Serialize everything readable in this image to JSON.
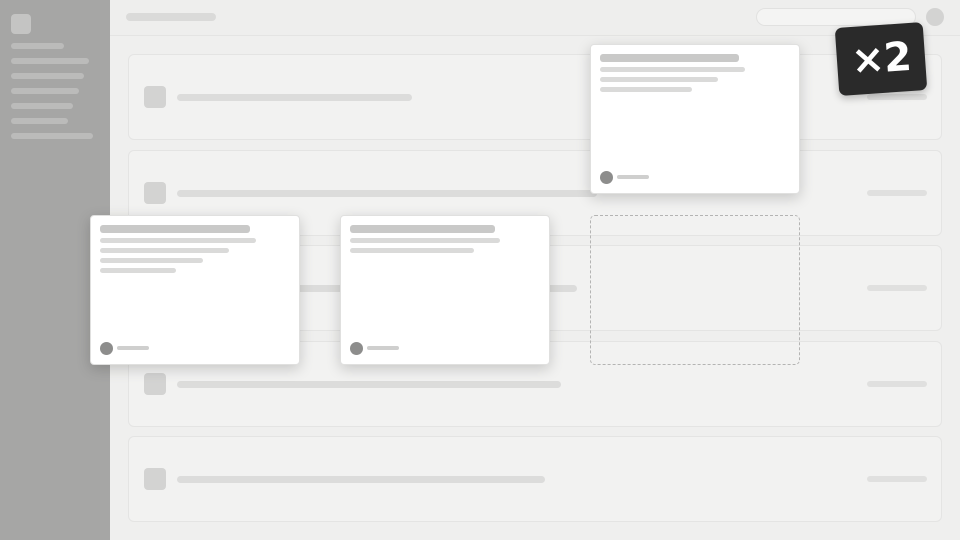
{
  "badge": {
    "multiplier": "×2"
  },
  "sidebar": {
    "item_count": 7
  },
  "rows": {
    "count": 5
  },
  "cards": {
    "count": 3
  },
  "colors": {
    "sidebar": "#a6a6a5",
    "background": "#efefee",
    "card": "#ffffff",
    "badge": "#2a2a2a",
    "badge_text": "#ffffff"
  }
}
